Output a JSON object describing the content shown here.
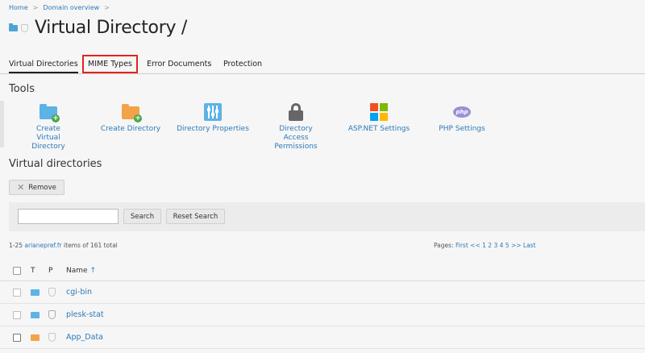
{
  "breadcrumb": [
    "Home",
    "Domain overview"
  ],
  "page": {
    "title": "Virtual Directory /"
  },
  "tabs": [
    "Virtual Directories",
    "MIME Types",
    "Error Documents",
    "Protection"
  ],
  "tools": {
    "title": "Tools",
    "items": [
      {
        "label": "Create Virtual Directory",
        "icon": "folder-add-icon"
      },
      {
        "label": "Create Directory",
        "icon": "folder-orange-add-icon"
      },
      {
        "label": "Directory Properties",
        "icon": "sliders-icon"
      },
      {
        "label": "Directory Access Permissions",
        "icon": "lock-icon"
      },
      {
        "label": "ASP.NET Settings",
        "icon": "windows-icon"
      },
      {
        "label": "PHP Settings",
        "icon": "php-icon"
      }
    ]
  },
  "vdirs": {
    "title": "Virtual directories",
    "remove_label": "Remove",
    "search_label": "Search",
    "reset_label": "Reset Search",
    "search_value": "",
    "info_prefix": "1-25",
    "info_link": "arianepref.fr",
    "info_suffix": "items of 161 total",
    "pager_label": "Pages:",
    "pager_first": "First",
    "pager_prev": "<<",
    "pager_pages": "1 2 3 4 5",
    "pager_next": ">>",
    "pager_last": "Last"
  },
  "table": {
    "col_t": "T",
    "col_p": "P",
    "col_name": "Name",
    "sort_indicator": "↑",
    "rows": [
      {
        "name": "cgi-bin",
        "folder_color": "#5db3e6"
      },
      {
        "name": "plesk-stat",
        "folder_color": "#5db3e6"
      },
      {
        "name": "App_Data",
        "folder_color": "#f3a347"
      }
    ]
  },
  "colors": {
    "link": "#2d79b8",
    "highlight": "#e3241b"
  }
}
